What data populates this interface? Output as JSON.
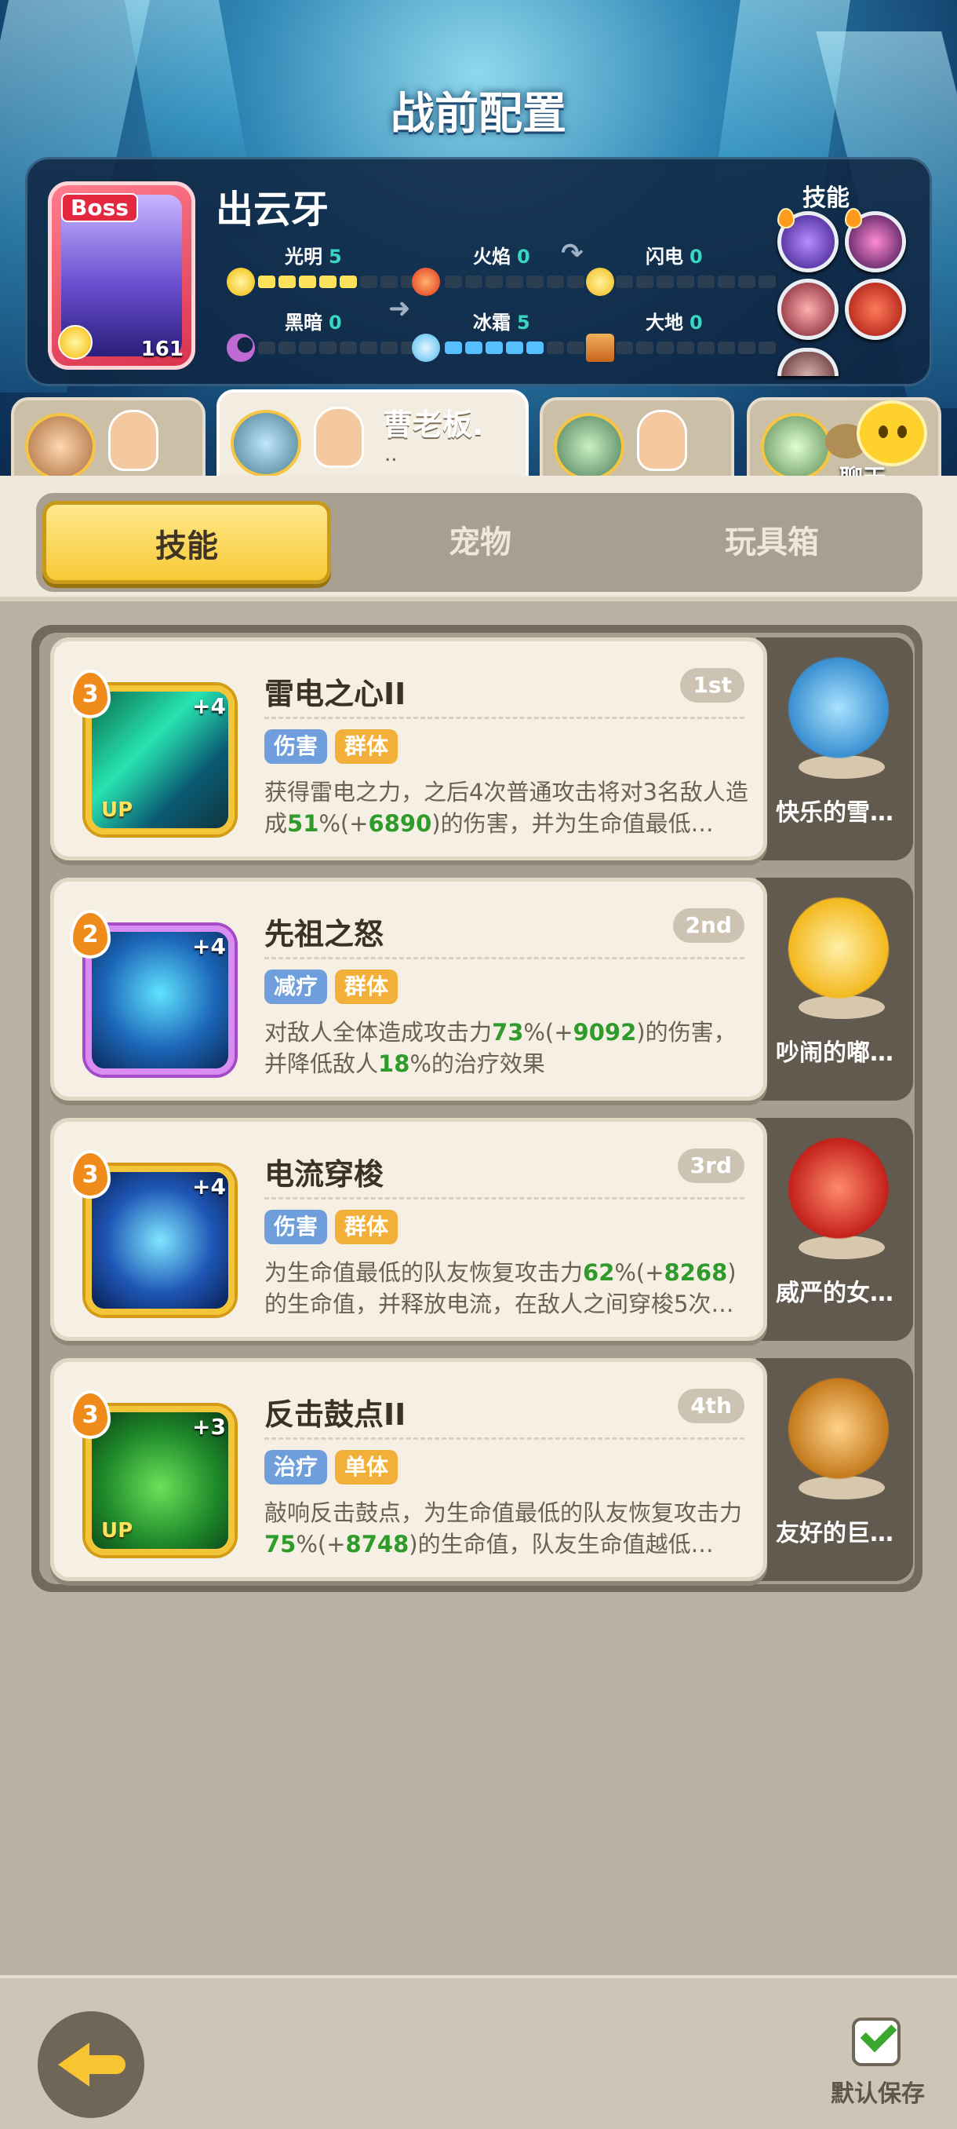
{
  "header": {
    "title": "战前配置"
  },
  "boss": {
    "tag": "Boss",
    "name": "出云牙",
    "level": "161",
    "attributes": [
      {
        "name": "光明",
        "value": "5"
      },
      {
        "name": "火焰",
        "value": "0"
      },
      {
        "name": "闪电",
        "value": "0"
      },
      {
        "name": "黑暗",
        "value": "0"
      },
      {
        "name": "冰霜",
        "value": "5"
      },
      {
        "name": "大地",
        "value": "0"
      }
    ],
    "skills_label": "技能"
  },
  "hero_tabs": [
    {
      "name": ""
    },
    {
      "name": "曹老板.",
      "sub": ".."
    },
    {
      "name": ""
    },
    {
      "name": ""
    }
  ],
  "chat": {
    "label": "聊天"
  },
  "tabs": [
    {
      "label": "技能"
    },
    {
      "label": "宠物"
    },
    {
      "label": "玩具箱"
    }
  ],
  "skills": [
    {
      "name": "雷电之心II",
      "rank": "1st",
      "level": "3",
      "plus": "+4",
      "up": "UP",
      "tags": [
        "伤害",
        "群体"
      ],
      "desc": {
        "a": "获得雷电之力，之后4次普通攻击将对3名敌人造成",
        "pct": "51",
        "b": "%(+",
        "num": "6890",
        "c": ")的伤害，并为生命值最低…"
      },
      "pet": "快乐的雪…"
    },
    {
      "name": "先祖之怒",
      "rank": "2nd",
      "level": "2",
      "plus": "+4",
      "up": "",
      "tags": [
        "减疗",
        "群体"
      ],
      "desc": {
        "a": "对敌人全体造成攻击力",
        "pct": "73",
        "b": "%(+",
        "num": "9092",
        "c": ")的伤害，并降低敌人",
        "pct2": "18",
        "d": "%的治疗效果"
      },
      "pet": "吵闹的嘟…"
    },
    {
      "name": "电流穿梭",
      "rank": "3rd",
      "level": "3",
      "plus": "+4",
      "up": "",
      "tags": [
        "伤害",
        "群体"
      ],
      "desc": {
        "a": "为生命值最低的队友恢复攻击力",
        "pct": "62",
        "b": "%(+",
        "num": "8268",
        "c": ")的生命值，并释放电流，在敌人之间穿梭5次…"
      },
      "pet": "威严的女…"
    },
    {
      "name": "反击鼓点II",
      "rank": "4th",
      "level": "3",
      "plus": "+3",
      "up": "UP",
      "tags": [
        "治疗",
        "单体"
      ],
      "desc": {
        "a": "敲响反击鼓点，为生命值最低的队友恢复攻击力",
        "pct": "75",
        "b": "%(+",
        "num": "8748",
        "c": ")的生命值，队友生命值越低…"
      },
      "pet": "友好的巨…"
    }
  ],
  "footer": {
    "save_label": "默认保存"
  }
}
